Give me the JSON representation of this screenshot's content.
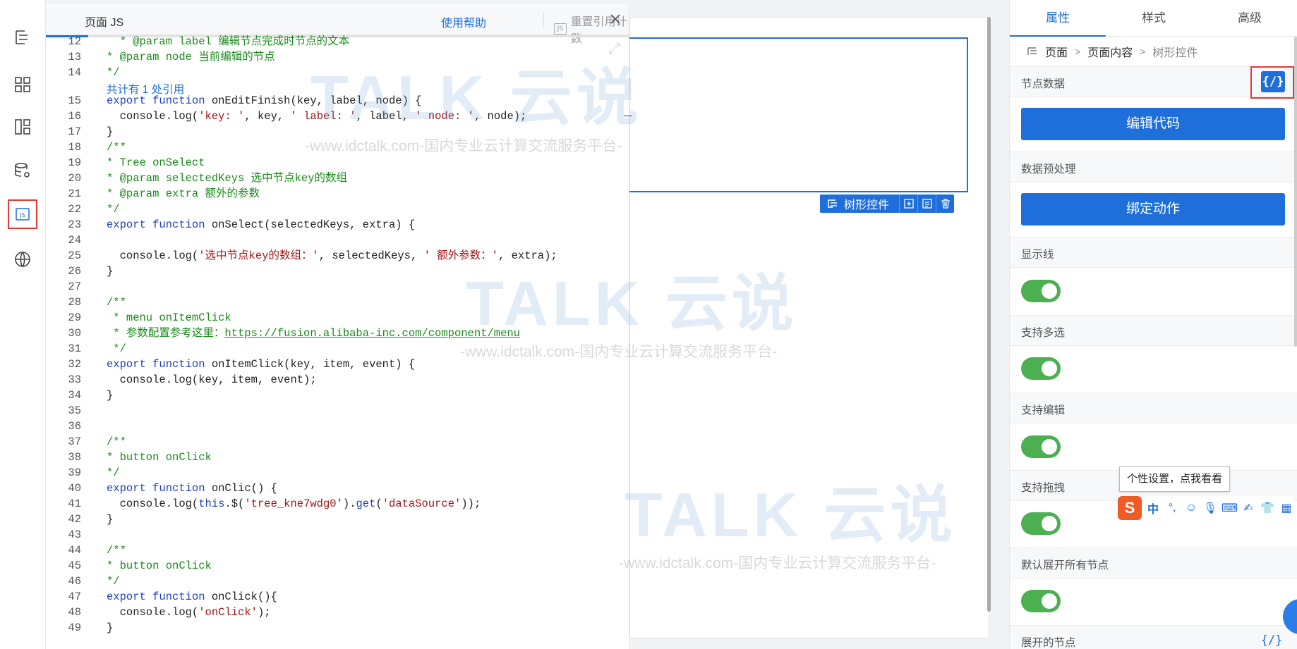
{
  "code_panel": {
    "title": "页面 JS",
    "help_label": "使用帮助",
    "reset_label": "重置引用计数",
    "js_badge": "JS",
    "reference_note": "共计有 1 处引用",
    "lines": [
      {
        "n": "12",
        "t": [
          {
            "c": "cm",
            "v": "  * @param label 编辑节点完成时节点的文本"
          }
        ]
      },
      {
        "n": "13",
        "t": [
          {
            "c": "cm",
            "v": "* @param node 当前编辑的节点"
          }
        ]
      },
      {
        "n": "14",
        "t": [
          {
            "c": "cm",
            "v": "*/"
          }
        ]
      },
      {
        "n": "15",
        "t": [
          {
            "c": "kw",
            "v": "export function "
          },
          {
            "c": "pl",
            "v": "onEditFinish(key, label, node) {"
          }
        ]
      },
      {
        "n": "16",
        "t": [
          {
            "c": "pl",
            "v": "  console.log("
          },
          {
            "c": "str",
            "v": "'key: '"
          },
          {
            "c": "pl",
            "v": ", key, "
          },
          {
            "c": "str",
            "v": "' label: '"
          },
          {
            "c": "pl",
            "v": ", label, "
          },
          {
            "c": "str",
            "v": "' node: '"
          },
          {
            "c": "pl",
            "v": ", node);"
          }
        ]
      },
      {
        "n": "17",
        "t": [
          {
            "c": "pl",
            "v": "}"
          }
        ]
      },
      {
        "n": "18",
        "t": [
          {
            "c": "cm",
            "v": "/**"
          }
        ]
      },
      {
        "n": "19",
        "t": [
          {
            "c": "cm",
            "v": "* Tree onSelect"
          }
        ]
      },
      {
        "n": "20",
        "t": [
          {
            "c": "cm",
            "v": "* @param selectedKeys 选中节点key的数组"
          }
        ]
      },
      {
        "n": "21",
        "t": [
          {
            "c": "cm",
            "v": "* @param extra 额外的参数"
          }
        ]
      },
      {
        "n": "22",
        "t": [
          {
            "c": "cm",
            "v": "*/"
          }
        ]
      },
      {
        "n": "23",
        "t": [
          {
            "c": "kw",
            "v": "export function "
          },
          {
            "c": "pl",
            "v": "onSelect(selectedKeys, extra) {"
          }
        ]
      },
      {
        "n": "24",
        "t": []
      },
      {
        "n": "25",
        "t": [
          {
            "c": "pl",
            "v": "  console.log("
          },
          {
            "c": "str",
            "v": "'选中节点key的数组：'"
          },
          {
            "c": "pl",
            "v": ", selectedKeys, "
          },
          {
            "c": "str",
            "v": "' 额外参数：'"
          },
          {
            "c": "pl",
            "v": ", extra);"
          }
        ]
      },
      {
        "n": "26",
        "t": [
          {
            "c": "pl",
            "v": "}"
          }
        ]
      },
      {
        "n": "27",
        "t": []
      },
      {
        "n": "28",
        "t": [
          {
            "c": "cm",
            "v": "/**"
          }
        ]
      },
      {
        "n": "29",
        "t": [
          {
            "c": "cm",
            "v": " * menu onItemClick"
          }
        ]
      },
      {
        "n": "30",
        "t": [
          {
            "c": "cm",
            "v": " * 参数配置参考这里："
          },
          {
            "c": "url",
            "v": "https://fusion.alibaba-inc.com/component/menu"
          }
        ]
      },
      {
        "n": "31",
        "t": [
          {
            "c": "cm",
            "v": " */"
          }
        ]
      },
      {
        "n": "32",
        "t": [
          {
            "c": "kw",
            "v": "export function "
          },
          {
            "c": "pl",
            "v": "onItemClick(key, item, event) {"
          }
        ]
      },
      {
        "n": "33",
        "t": [
          {
            "c": "pl",
            "v": "  console.log(key, item, event);"
          }
        ]
      },
      {
        "n": "34",
        "t": [
          {
            "c": "pl",
            "v": "}"
          }
        ]
      },
      {
        "n": "35",
        "t": []
      },
      {
        "n": "36",
        "t": []
      },
      {
        "n": "37",
        "t": [
          {
            "c": "cm",
            "v": "/**"
          }
        ]
      },
      {
        "n": "38",
        "t": [
          {
            "c": "cm",
            "v": "* button onClick"
          }
        ]
      },
      {
        "n": "39",
        "t": [
          {
            "c": "cm",
            "v": "*/"
          }
        ]
      },
      {
        "n": "40",
        "t": [
          {
            "c": "kw",
            "v": "export function "
          },
          {
            "c": "pl",
            "v": "onClic() {"
          }
        ]
      },
      {
        "n": "41",
        "t": [
          {
            "c": "pl",
            "v": "  console.log("
          },
          {
            "c": "kw",
            "v": "this"
          },
          {
            "c": "pl",
            "v": ".$("
          },
          {
            "c": "str",
            "v": "'tree_kne7wdg0'"
          },
          {
            "c": "pl",
            "v": ")."
          },
          {
            "c": "kw",
            "v": "get"
          },
          {
            "c": "pl",
            "v": "("
          },
          {
            "c": "str",
            "v": "'dataSource'"
          },
          {
            "c": "pl",
            "v": "));"
          }
        ]
      },
      {
        "n": "42",
        "t": [
          {
            "c": "pl",
            "v": "}"
          }
        ]
      },
      {
        "n": "43",
        "t": []
      },
      {
        "n": "44",
        "t": [
          {
            "c": "cm",
            "v": "/**"
          }
        ]
      },
      {
        "n": "45",
        "t": [
          {
            "c": "cm",
            "v": "* button onClick"
          }
        ]
      },
      {
        "n": "46",
        "t": [
          {
            "c": "cm",
            "v": "*/"
          }
        ]
      },
      {
        "n": "47",
        "t": [
          {
            "c": "kw",
            "v": "export function "
          },
          {
            "c": "pl",
            "v": "onClick(){"
          }
        ]
      },
      {
        "n": "48",
        "t": [
          {
            "c": "pl",
            "v": "  console.log("
          },
          {
            "c": "str",
            "v": "'onClick'"
          },
          {
            "c": "pl",
            "v": ");"
          }
        ]
      },
      {
        "n": "49",
        "t": [
          {
            "c": "pl",
            "v": "}"
          }
        ]
      }
    ]
  },
  "canvas": {
    "component_tag": "树形控件"
  },
  "settings": {
    "tabs": [
      "属性",
      "样式",
      "高级"
    ],
    "active_tab": "属性",
    "breadcrumb": [
      "页面",
      "页面内容",
      "树形控件"
    ],
    "node_data_label": "节点数据",
    "code_symbol": "{/}",
    "edit_code_label": "编辑代码",
    "preprocess_label": "数据预处理",
    "bind_action_label": "绑定动作",
    "toggles": [
      {
        "label": "显示线",
        "on": true
      },
      {
        "label": "支持多选",
        "on": true
      },
      {
        "label": "支持编辑",
        "on": true
      },
      {
        "label": "支持拖拽",
        "on": true
      },
      {
        "label": "默认展开所有节点",
        "on": true
      }
    ],
    "expanded_nodes_label": "展开的节点"
  },
  "ime": {
    "tooltip": "个性设置，点我看看",
    "logo": "S",
    "mode": "中",
    "punct": "°,"
  },
  "watermark": {
    "brand": "TALK 云说",
    "url": "-www.idctalk.com-国内专业云计算交流服务平台-"
  },
  "colors": {
    "accent": "#1e6fd9",
    "toggle_on": "#4caf50",
    "highlight": "#e53935"
  }
}
